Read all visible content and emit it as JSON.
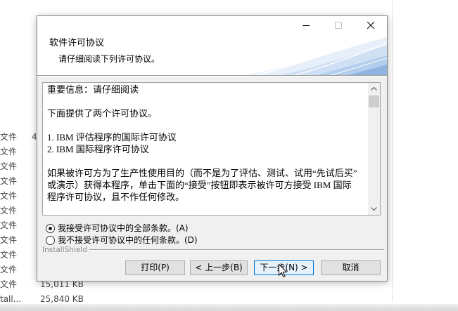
{
  "colors": {
    "accent": "#0078d7",
    "button_focus_bg": "#e5f1fb",
    "dialog_body": "#f0f0f0"
  },
  "icons": {
    "minimize": "minimize-icon",
    "maximize": "maximize-icon",
    "close": "close-icon",
    "scroll_up": "chevron-up-icon",
    "scroll_down": "chevron-down-icon",
    "cursor": "mouse-cursor-icon"
  },
  "background": {
    "file_rows": [
      {
        "type": "文件",
        "size": "4"
      },
      {
        "type": "文件"
      },
      {
        "type": "文件"
      },
      {
        "type": "文件"
      },
      {
        "type": "文件"
      },
      {
        "type": "文件"
      },
      {
        "type": "文件"
      },
      {
        "type": "文件"
      },
      {
        "type": "文件"
      },
      {
        "type": "文件"
      },
      {
        "type": "文件",
        "size": "15,011 KB"
      },
      {
        "type": "tall...",
        "size": "25,840 KB"
      }
    ]
  },
  "dialog": {
    "header": {
      "title": "软件许可协议",
      "subtitle": "请仔细阅读下列许可协议。"
    },
    "license": {
      "heading": "重要信息：请仔细阅读",
      "intro": "下面提供了两个许可协议。",
      "agreements": [
        "1. IBM 评估程序的国际许可协议",
        "2. IBM 国际程序许可协议"
      ],
      "paragraph_lines": [
        "如果被许可方为了生产性使用目的（而不是为了评估、测试、试用“先试后买”",
        "或演示）获得本程序，单击下面的“接受”按钮即表示被许可方接受 IBM 国际",
        "程序许可协议，且不作任何修改。"
      ]
    },
    "options": [
      {
        "label": "我接受许可协议中的全部条款。(A)",
        "selected": true
      },
      {
        "label": "我不接受许可协议中的任何条款。(D)",
        "selected": false
      }
    ],
    "brand": "InstallShield",
    "buttons": {
      "print": {
        "label": "打印(P)",
        "focused": false
      },
      "back": {
        "label": "< 上一步(B)",
        "focused": false
      },
      "next": {
        "label": "下一步(N) >",
        "focused": true
      },
      "cancel": {
        "label": "取消",
        "focused": false
      }
    }
  }
}
